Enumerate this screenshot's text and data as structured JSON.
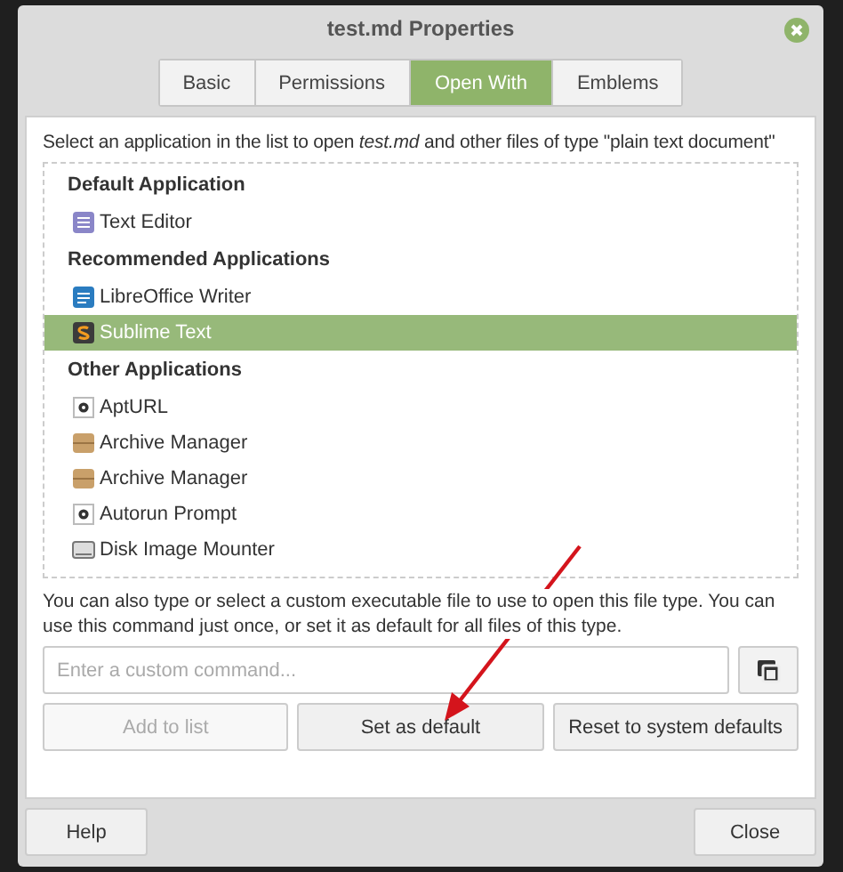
{
  "window": {
    "title": "test.md Properties"
  },
  "tabs": [
    {
      "label": "Basic",
      "selected": false
    },
    {
      "label": "Permissions",
      "selected": false
    },
    {
      "label": "Open With",
      "selected": true
    },
    {
      "label": "Emblems",
      "selected": false
    }
  ],
  "description": "Select an application in the list to open *test.md* and other files of type \"plain text document\"",
  "sections": [
    {
      "heading": "Default Application",
      "apps": [
        {
          "name": "Text Editor",
          "kind": "editor",
          "selected": false
        }
      ]
    },
    {
      "heading": "Recommended Applications",
      "apps": [
        {
          "name": "LibreOffice Writer",
          "kind": "writer",
          "selected": false
        },
        {
          "name": "Sublime Text",
          "kind": "sublime",
          "selected": true
        }
      ]
    },
    {
      "heading": "Other Applications",
      "apps": [
        {
          "name": "AptURL",
          "kind": "gear",
          "selected": false
        },
        {
          "name": "Archive Manager",
          "kind": "archive",
          "selected": false
        },
        {
          "name": "Archive Manager",
          "kind": "archive",
          "selected": false
        },
        {
          "name": "Autorun Prompt",
          "kind": "gear",
          "selected": false
        },
        {
          "name": "Disk Image Mounter",
          "kind": "disk",
          "selected": false
        }
      ]
    }
  ],
  "custom_hint": "You can also type or select a custom executable file to use to open this file type.  You can use this command just once, or set it as default for all files of this type.",
  "command_field": {
    "placeholder": "Enter a custom command..."
  },
  "action_buttons": [
    {
      "label": "Add to list",
      "disabled": true
    },
    {
      "label": "Set as default",
      "disabled": false
    },
    {
      "label": "Reset to system defaults",
      "disabled": false
    }
  ],
  "footer_buttons": [
    {
      "label": "Help"
    },
    {
      "label": "Close"
    }
  ]
}
